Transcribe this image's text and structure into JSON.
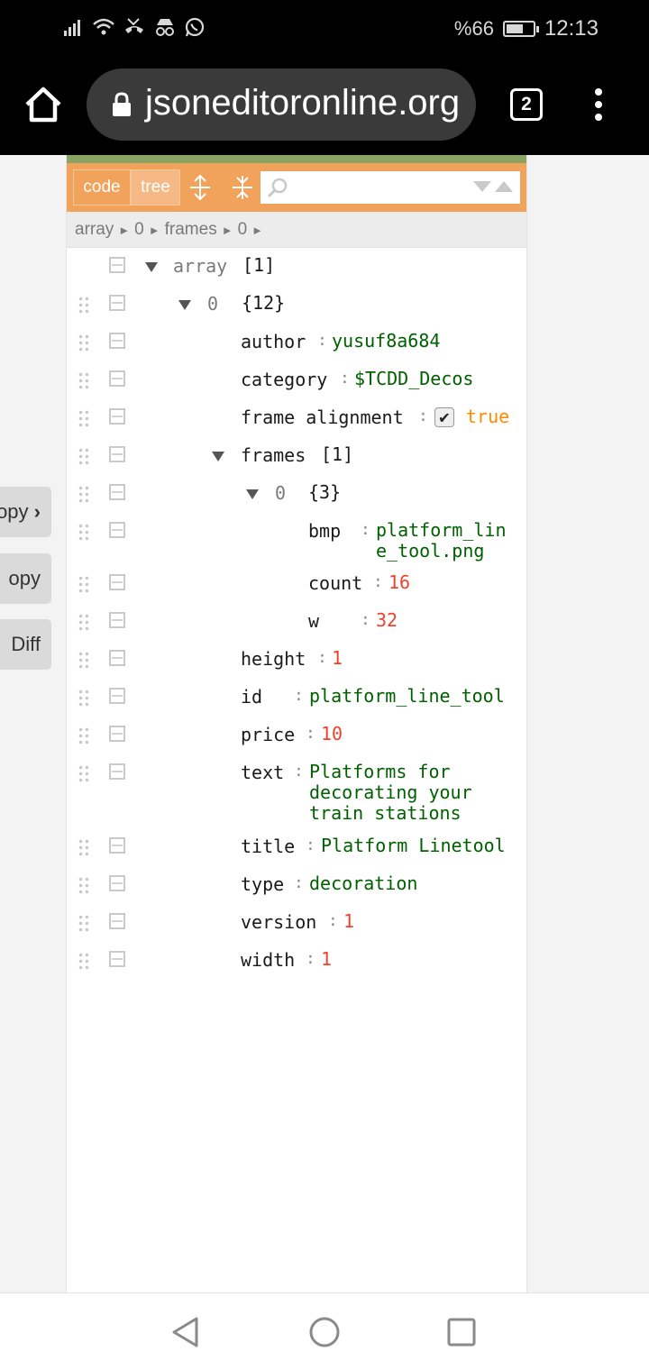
{
  "status_bar": {
    "battery_text": "%66",
    "battery_level": 0.66,
    "time": "12:13",
    "icons": [
      "signal-icon",
      "wifi-icon",
      "missed-call-icon",
      "incognito-icon",
      "whatsapp-icon"
    ]
  },
  "browser": {
    "url": "jsoneditoronline.org",
    "tab_count": "2"
  },
  "side_panel": {
    "copy_right_label": "opy",
    "copy_label": "opy",
    "diff_label": "Diff"
  },
  "toolbar": {
    "code_label": "code",
    "tree_label": "tree",
    "search_placeholder": ""
  },
  "breadcrumb": [
    "array",
    "0",
    "frames",
    "0"
  ],
  "tree": {
    "root": {
      "key": "array",
      "meta": "[1]"
    },
    "item0": {
      "key": "0",
      "meta": "{12}"
    },
    "author": {
      "key": "author",
      "value": "yusuf8a684"
    },
    "category": {
      "key": "category",
      "value": "$TCDD_Decos"
    },
    "frame_alignment": {
      "key": "frame alignment",
      "value": "true"
    },
    "frames": {
      "key": "frames",
      "meta": "[1]"
    },
    "frames0": {
      "key": "0",
      "meta": "{3}"
    },
    "bmp": {
      "key": "bmp",
      "value": "platform_lin\ne_tool.png"
    },
    "count": {
      "key": "count",
      "value": "16"
    },
    "w": {
      "key": "w",
      "value": "32"
    },
    "height": {
      "key": "height",
      "value": "1"
    },
    "id": {
      "key": "id",
      "value": "platform_line_tool"
    },
    "price": {
      "key": "price",
      "value": "10"
    },
    "text": {
      "key": "text",
      "value": "Platforms for\ndecorating your\ntrain stations"
    },
    "title": {
      "key": "title",
      "value": "Platform Linetool"
    },
    "type": {
      "key": "type",
      "value": "decoration"
    },
    "version": {
      "key": "version",
      "value": "1"
    },
    "width": {
      "key": "width",
      "value": "1"
    }
  },
  "colors": {
    "accent_orange": "#f2a35b",
    "top_green": "#8aa262",
    "string_green": "#006000",
    "number_red": "#ee422e",
    "boolean_orange": "#ff8c00"
  }
}
